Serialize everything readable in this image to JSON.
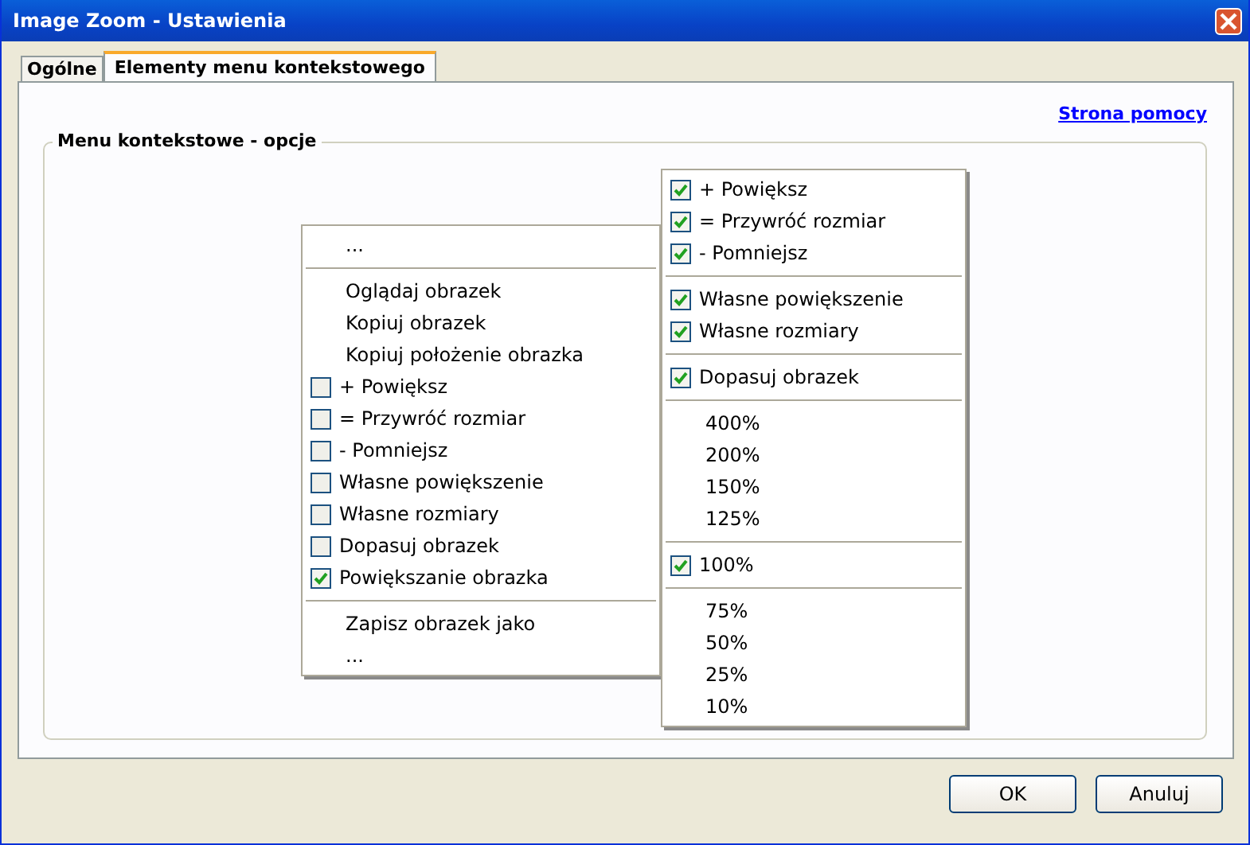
{
  "window": {
    "title": "Image Zoom - Ustawienia"
  },
  "tabs": [
    {
      "label": "Ogólne",
      "selected": false
    },
    {
      "label": "Elementy menu kontekstowego",
      "selected": true
    }
  ],
  "help_link": "Strona pomocy",
  "group": {
    "title": "Menu kontekstowe - opcje"
  },
  "left_menu": [
    {
      "kind": "text",
      "label": "..."
    },
    {
      "kind": "separator"
    },
    {
      "kind": "text",
      "label": "Oglądaj obrazek"
    },
    {
      "kind": "text",
      "label": "Kopiuj obrazek"
    },
    {
      "kind": "text",
      "label": "Kopiuj położenie obrazka"
    },
    {
      "kind": "check",
      "label": "+ Powiększ",
      "checked": false
    },
    {
      "kind": "check",
      "label": "= Przywróć rozmiar",
      "checked": false
    },
    {
      "kind": "check",
      "label": "- Pomniejsz",
      "checked": false
    },
    {
      "kind": "check",
      "label": "Własne powiększenie",
      "checked": false
    },
    {
      "kind": "check",
      "label": "Własne rozmiary",
      "checked": false
    },
    {
      "kind": "check",
      "label": "Dopasuj obrazek",
      "checked": false
    },
    {
      "kind": "check",
      "label": "Powiększanie obrazka",
      "checked": true
    },
    {
      "kind": "separator"
    },
    {
      "kind": "text",
      "label": "Zapisz obrazek jako"
    },
    {
      "kind": "text",
      "label": "..."
    }
  ],
  "right_menu": [
    {
      "kind": "check",
      "label": "+ Powiększ",
      "checked": true
    },
    {
      "kind": "check",
      "label": "= Przywróć rozmiar",
      "checked": true
    },
    {
      "kind": "check",
      "label": "- Pomniejsz",
      "checked": true
    },
    {
      "kind": "separator"
    },
    {
      "kind": "check",
      "label": "Własne powiększenie",
      "checked": true
    },
    {
      "kind": "check",
      "label": "Własne rozmiary",
      "checked": true
    },
    {
      "kind": "separator"
    },
    {
      "kind": "check",
      "label": "Dopasuj obrazek",
      "checked": true
    },
    {
      "kind": "separator"
    },
    {
      "kind": "text",
      "label": "400%"
    },
    {
      "kind": "text",
      "label": "200%"
    },
    {
      "kind": "text",
      "label": "150%"
    },
    {
      "kind": "text",
      "label": "125%"
    },
    {
      "kind": "separator"
    },
    {
      "kind": "check",
      "label": "100%",
      "checked": true
    },
    {
      "kind": "separator"
    },
    {
      "kind": "text",
      "label": "75%"
    },
    {
      "kind": "text",
      "label": "50%"
    },
    {
      "kind": "text",
      "label": "25%"
    },
    {
      "kind": "text",
      "label": "10%"
    }
  ],
  "buttons": [
    "OK",
    "Anuluj"
  ]
}
